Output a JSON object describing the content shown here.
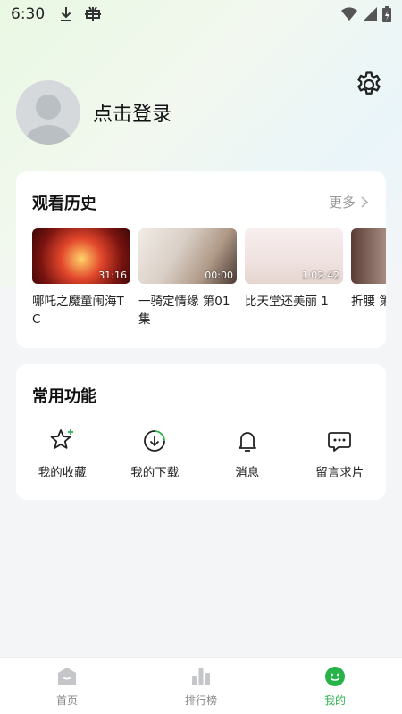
{
  "status_bar": {
    "time": "6:30"
  },
  "profile": {
    "login_text": "点击登录"
  },
  "history": {
    "title": "观看历史",
    "more_label": "更多",
    "items": [
      {
        "title": "哪吒之魔童闹海TC",
        "duration": "31:16"
      },
      {
        "title": "一骑定情缘 第01集",
        "duration": "00:00"
      },
      {
        "title": "比天堂还美丽 1",
        "duration": "1:02:42"
      },
      {
        "title": "折腰 第",
        "duration": ""
      }
    ]
  },
  "functions": {
    "title": "常用功能",
    "items": [
      {
        "label": "我的收藏",
        "icon": "star-icon"
      },
      {
        "label": "我的下载",
        "icon": "download-icon"
      },
      {
        "label": "消息",
        "icon": "bell-icon"
      },
      {
        "label": "留言求片",
        "icon": "message-icon"
      }
    ]
  },
  "bottom_nav": {
    "items": [
      {
        "label": "首页",
        "icon": "home-icon",
        "active": false
      },
      {
        "label": "排行榜",
        "icon": "ranking-icon",
        "active": false
      },
      {
        "label": "我的",
        "icon": "profile-icon",
        "active": true
      }
    ]
  },
  "colors": {
    "accent": "#27b24a",
    "inactive": "#c4c6c9"
  }
}
